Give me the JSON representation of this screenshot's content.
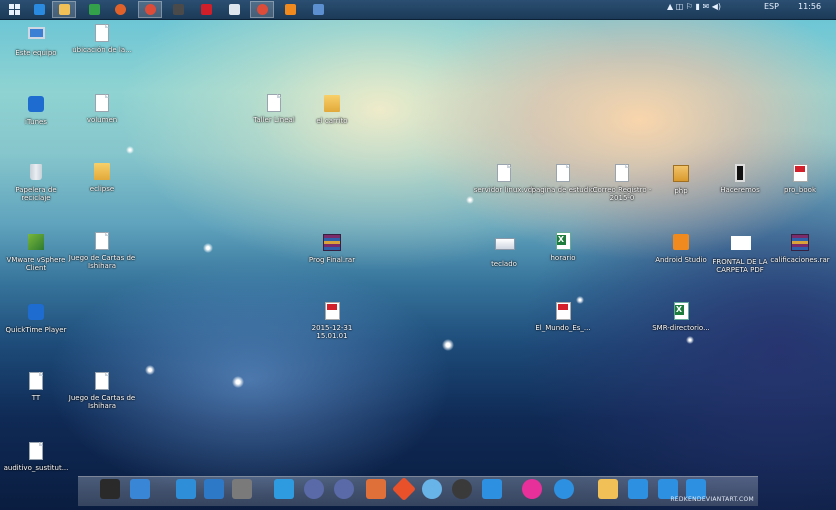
{
  "taskbar": {
    "start_icon": "windows-logo-icon",
    "pinned": [
      {
        "name": "internet-explorer",
        "icon": "ie-icon",
        "color": "#2a8ae0"
      },
      {
        "name": "file-explorer",
        "icon": "folder-icon",
        "color": "#f1c056"
      },
      {
        "name": "store",
        "icon": "green-app-icon",
        "color": "#33a04a"
      },
      {
        "name": "firefox",
        "icon": "firefox-icon",
        "color": "#e0622a"
      },
      {
        "name": "chrome",
        "icon": "chrome-icon",
        "color": "#dd4b39"
      },
      {
        "name": "media",
        "icon": "film-icon",
        "color": "#4a4a4a"
      },
      {
        "name": "acrobat",
        "icon": "pdf-icon",
        "color": "#d11f2a"
      },
      {
        "name": "notepad",
        "icon": "notepad-icon",
        "color": "#dfe6ee"
      },
      {
        "name": "chrome-2",
        "icon": "chrome-icon",
        "color": "#dd4b39"
      },
      {
        "name": "home",
        "icon": "home-icon",
        "color": "#f08a1e"
      },
      {
        "name": "app",
        "icon": "blue-app-icon",
        "color": "#5b8fd0"
      }
    ],
    "tray": {
      "language": "ESP",
      "time": "11:56"
    }
  },
  "desktop_icons": [
    {
      "label": "Este equipo",
      "type": "computer"
    },
    {
      "label": "ubicación de la...",
      "type": "doc"
    },
    {
      "label": "iTunes",
      "type": "blue-app"
    },
    {
      "label": "volumen",
      "type": "doc"
    },
    {
      "label": "Taller Lineal",
      "type": "doc"
    },
    {
      "label": "el carrito",
      "type": "folder"
    },
    {
      "label": "Papelera de reciclaje",
      "type": "bin"
    },
    {
      "label": "eclipse",
      "type": "folder"
    },
    {
      "label": "servidor linux.vdi",
      "type": "doc"
    },
    {
      "label": "pagina de estudio",
      "type": "doc"
    },
    {
      "label": "Correo Registro - 2015-0",
      "type": "doc"
    },
    {
      "label": "php",
      "type": "folder-dark"
    },
    {
      "label": "Haceremos",
      "type": "phone"
    },
    {
      "label": "pro_book",
      "type": "pdf"
    },
    {
      "label": "VMware vSphere Client",
      "type": "green-app"
    },
    {
      "label": "Juego de Cartas de Ishihara",
      "type": "doc"
    },
    {
      "label": "Prog Final.rar",
      "type": "rar"
    },
    {
      "label": "teclado",
      "type": "note"
    },
    {
      "label": "horario",
      "type": "xls"
    },
    {
      "label": "Android Studio",
      "type": "orange-app"
    },
    {
      "label": "FRONTAL DE LA CARPETA PDF",
      "type": "white-sq"
    },
    {
      "label": "calificaciones.rar",
      "type": "rar"
    },
    {
      "label": "QuickTime Player",
      "type": "blue-app"
    },
    {
      "label": "2015-12-31 15.01.01",
      "type": "pdf"
    },
    {
      "label": "El_Mundo_Es_...",
      "type": "pdf"
    },
    {
      "label": "SMR-directorio...",
      "type": "xls"
    },
    {
      "label": "TT",
      "type": "doc"
    },
    {
      "label": "Juego de Cartas de Ishihara",
      "type": "doc"
    },
    {
      "label": "auditivo_sustitut...",
      "type": "doc"
    }
  ],
  "dock": {
    "items": [
      {
        "name": "terminal",
        "icon": "terminal-icon",
        "color": "#2a2a2a"
      },
      {
        "name": "network",
        "icon": "network-icon",
        "color": "#3a86d6"
      },
      {
        "name": "devices",
        "icon": "devices-icon",
        "color": "#2e8fd8"
      },
      {
        "name": "maximize",
        "icon": "window-icon",
        "color": "#2e78c8"
      },
      {
        "name": "virtualbox",
        "icon": "box-icon",
        "color": "#7a7a7a"
      },
      {
        "name": "screenshot",
        "icon": "crop-icon",
        "color": "#2e9be0"
      },
      {
        "name": "disc-1",
        "icon": "disc-icon",
        "color": "#5a6aa8"
      },
      {
        "name": "disc-2",
        "icon": "disc-icon",
        "color": "#5a6aa8"
      },
      {
        "name": "settings",
        "icon": "dollar-icon",
        "color": "#e0703a"
      },
      {
        "name": "git",
        "icon": "git-icon",
        "color": "#e8512a"
      },
      {
        "name": "finder-1",
        "icon": "cat-icon",
        "color": "#68b4e8"
      },
      {
        "name": "finder-2",
        "icon": "cat-icon",
        "color": "#3a3a3a"
      },
      {
        "name": "home",
        "icon": "home-icon",
        "color": "#2e90e0"
      },
      {
        "name": "app-pink",
        "icon": "pink-app-icon",
        "color": "#e8309a"
      },
      {
        "name": "browser",
        "icon": "edge-icon",
        "color": "#2e90e0"
      },
      {
        "name": "folder-yellow",
        "icon": "folder-icon",
        "color": "#f1c056"
      },
      {
        "name": "folder-blue",
        "icon": "folder-icon",
        "color": "#2e90e0"
      },
      {
        "name": "monitor",
        "icon": "monitor-icon",
        "color": "#2e90e0"
      },
      {
        "name": "gear",
        "icon": "gear-icon",
        "color": "#2e90e0"
      }
    ]
  },
  "watermark": "REDKENDEVIANTART.COM"
}
